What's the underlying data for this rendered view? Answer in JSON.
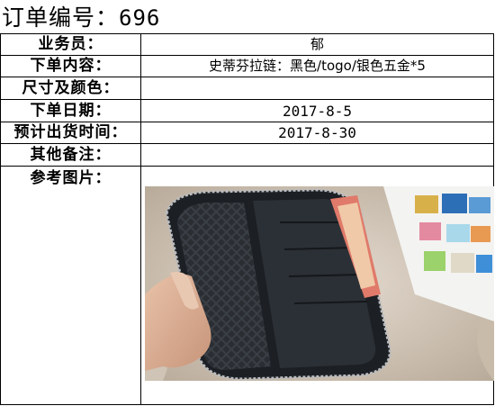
{
  "order": {
    "title_prefix": "订单编号：",
    "number": "696"
  },
  "rows": [
    {
      "label": "业务员：",
      "value": "郁"
    },
    {
      "label": "下单内容：",
      "value": "史蒂芬拉链：黑色/togo/银色五金*5"
    },
    {
      "label": "尺寸及颜色：",
      "value": ""
    },
    {
      "label": "下单日期：",
      "value": "2017-8-5"
    },
    {
      "label": "预计出货时间：",
      "value": "2017-8-30"
    },
    {
      "label": "其他备注：",
      "value": ""
    }
  ],
  "reference": {
    "label": "参考图片："
  },
  "colors": {
    "border": "#000000",
    "wallet": "#1f2328",
    "fur": "#d9cfc2"
  }
}
